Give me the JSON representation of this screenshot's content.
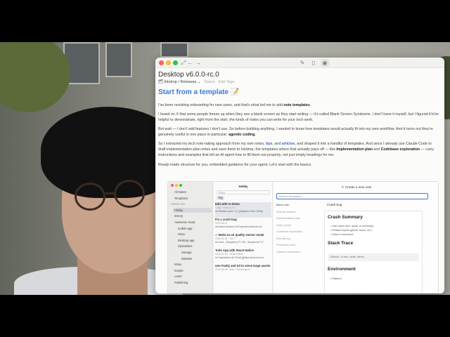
{
  "window": {
    "doc_title": "Desktop v6.0.0-rc.0",
    "breadcrumb": {
      "notebook": "Inkdrop",
      "sep": "/",
      "folder": "Releases",
      "status": "Status",
      "tags": "Add Tags"
    }
  },
  "article": {
    "heading": "Start from a template",
    "heading_emoji": "📝",
    "p1_pre": "I've been revisiting onboarding for new users, and that's what led me to add ",
    "p1_bold": "note templates",
    "p1_post": ".",
    "p2": "I heard on X that some people freeze up when they see a blank screen as they start writing — it's called Blank Screen Syndrome. I don't have it myself, but I figured it'd be helpful to demonstrate, right from the start, the kinds of notes you can write for your tech work.",
    "p3_pre": "But wait — I don't add features I don't use. So before building anything, I wanted to know how templates would actually fit into my own workflow. And it turns out they're genuinely useful in one place in particular: ",
    "p3_bold": "agentic coding",
    "p3_post": ".",
    "p4_a": "So I extracted my tech note-taking approach from my own notes, ",
    "p4_tips": "tips",
    "p4_b": ", and ",
    "p4_articles": "articles",
    "p4_c": ", and shaped it into a handful of templates. And since I already use Claude Code to draft implementation-plan notes and save them to Inkdrop, the templates where that actually pays off — like ",
    "p4_bold1": "Implementation plan",
    "p4_d": " and ",
    "p4_bold2": "Codebase exploration",
    "p4_e": " — carry instructions and examples that tell an AI agent how to fill them out properly, not just empty headings for me.",
    "p5": "Ready-made structure for you, embedded guidance for your agent. Let's start with the basics."
  },
  "inner": {
    "sidebar": [
      {
        "label": "All Notes",
        "indent": 1,
        "selected": false,
        "header": false
      },
      {
        "label": "Templates",
        "indent": 1,
        "selected": false,
        "header": false
      },
      {
        "label": "Notebooks",
        "indent": 0,
        "selected": false,
        "header": true
      },
      {
        "label": "Hobby",
        "indent": 1,
        "selected": true,
        "header": false
      },
      {
        "label": "Emory",
        "indent": 1,
        "selected": false,
        "header": false
      },
      {
        "label": "Awesome SaaS",
        "indent": 1,
        "selected": false,
        "header": false
      },
      {
        "label": "mobile app",
        "indent": 2,
        "selected": false,
        "header": false
      },
      {
        "label": "Inbox",
        "indent": 2,
        "selected": false,
        "header": false
      },
      {
        "label": "Desktop app",
        "indent": 2,
        "selected": false,
        "header": false
      },
      {
        "label": "Operations",
        "indent": 2,
        "selected": false,
        "header": false
      },
      {
        "label": "Storage",
        "indent": 3,
        "selected": false,
        "header": false
      },
      {
        "label": "Website",
        "indent": 3,
        "selected": false,
        "header": false
      },
      {
        "label": "Inbox",
        "indent": 1,
        "selected": false,
        "header": false
      },
      {
        "label": "Inspire",
        "indent": 1,
        "selected": false,
        "header": false
      },
      {
        "label": "Learn",
        "indent": 1,
        "selected": false,
        "header": false
      },
      {
        "label": "Publishing",
        "indent": 1,
        "selected": false,
        "header": false
      }
    ],
    "list_title": "Hobby",
    "list_filter": "Filter",
    "list_tag": "Tag",
    "notes": [
      {
        "title": "Edit with AI demo",
        "meta": "1 day · main v1.2.1",
        "body": "## Related notes: 1 [ ] [Migration Plan: Helley"
      },
      {
        "title": "Fix a crash bug",
        "meta": "2025-06-07",
        "body": "## Actual behavior ## Expected behavior ##"
      },
      {
        "title": "✓ Make an air quality sensor mode",
        "meta": "2024-05-28 · Jun 7 ·",
        "body": "## Links - [Raspberry Pi OS] - Raspberry Pi Z"
      },
      {
        "title": "Todo App with React Native",
        "meta": "2024-04-28 · React Native",
        "body": "## Inspirations ## Check [][https://plus.lore.ca"
      },
      {
        "title": "Use Fastly and S3 to serve large assets",
        "meta": "2024-05-08 · Web · Performance",
        "body": ""
      }
    ],
    "panel": {
      "create_label": "Create a new note",
      "search_placeholder": "Search templates...",
      "templates": [
        {
          "label": "Blank note",
          "active": true
        },
        {
          "label": "Feature request",
          "active": false
        },
        {
          "label": "Implementation plan",
          "active": false
        },
        {
          "label": "Daily journal",
          "active": false
        },
        {
          "label": "Codebase exploration",
          "active": false
        },
        {
          "label": "Security log",
          "active": false
        },
        {
          "label": "Frequently used",
          "active": false
        },
        {
          "label": "Options comparison",
          "active": false
        }
      ],
      "preview_title": "Crash bug",
      "preview_h1": "Crash Summary",
      "preview_bullets": [
        "User report (link, quote, or summary)",
        "Related reports (github, forum, etc.)",
        "Steps to reproduce"
      ],
      "preview_h2": "Stack Trace",
      "preview_code": "(Paste trace code here)",
      "preview_h3": "Environment",
      "preview_bullet4": "Platform"
    }
  }
}
